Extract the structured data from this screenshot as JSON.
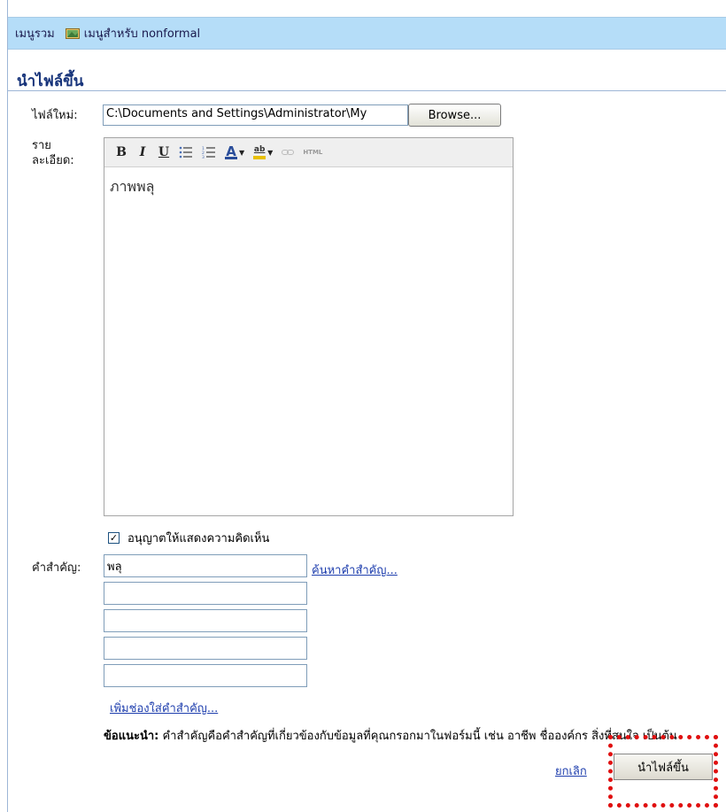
{
  "topbar": {
    "menu_all": "เมนูรวม",
    "menu_sub": "เมนูสำหรับ nonformal",
    "folder_icon": "folder-picture-icon"
  },
  "page": {
    "title": "นำไฟล์ขึ้น"
  },
  "form": {
    "file_label": "ไฟล์ใหม่:",
    "file_value": "C:\\Documents and Settings\\Administrator\\My",
    "browse_label": "Browse...",
    "desc_label_line1": "ราย",
    "desc_label_line2": "ละเอียด:",
    "editor": {
      "toolbar": {
        "bold": "B",
        "italic": "I",
        "underline": "U",
        "html": "HTML",
        "font_color_glyph": "A",
        "highlight_glyph": "ab"
      },
      "content": "ภาพพลุ"
    },
    "allow_comments_label": "อนุญาตให้แสดงความคิดเห็น",
    "allow_comments_checked": true,
    "keyword_label": "คำสำคัญ:",
    "keywords": [
      "พลุ",
      "",
      "",
      "",
      ""
    ],
    "search_keyword_link": "ค้นหาคำสำคัญ...",
    "add_keyword_link": "เพิ่มช่องใส่คำสำคัญ...",
    "tip_title": "ข้อแนะนำ:",
    "tip_text": "คำสำคัญคือคำสำคัญที่เกี่ยวข้องกับข้อมูลที่คุณกรอกมาในฟอร์มนี้ เช่น อาชีพ ชื่อองค์กร สิ่งที่สนใจ เป็นต้น",
    "cancel_link": "ยกเลิก",
    "submit_label": "นำไฟล์ขึ้น"
  },
  "colors": {
    "topbar_bg": "#b5ddf8",
    "title": "#16337a",
    "link": "#1f3fae",
    "highlight_border": "#e01010"
  }
}
